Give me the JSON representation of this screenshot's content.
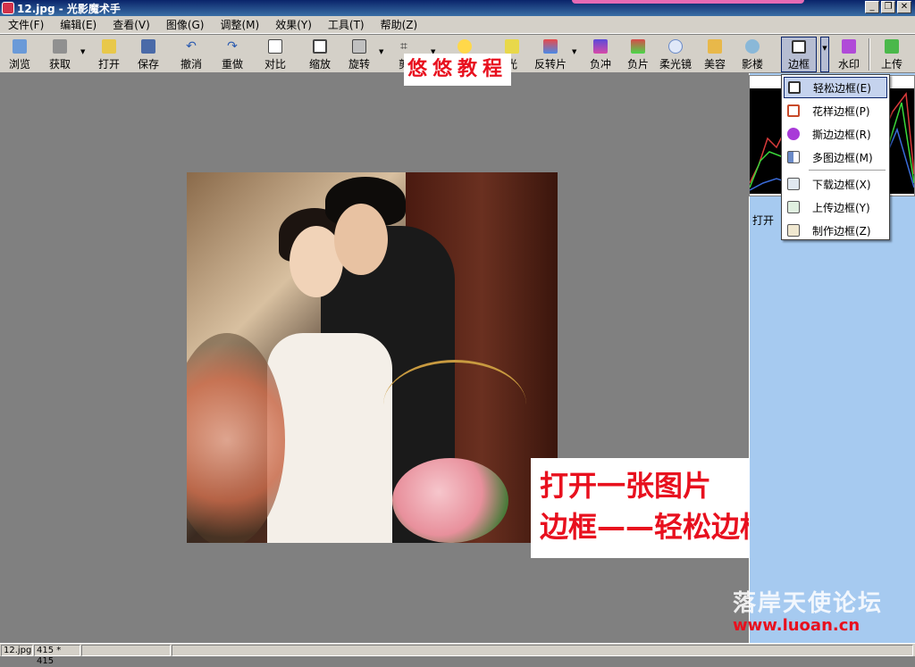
{
  "window": {
    "title": "12.jpg - 光影魔术手"
  },
  "menu": [
    "文件(F)",
    "编辑(E)",
    "查看(V)",
    "图像(G)",
    "调整(M)",
    "效果(Y)",
    "工具(T)",
    "帮助(Z)"
  ],
  "toolbar": {
    "browse": "浏览",
    "acquire": "获取",
    "open": "打开",
    "save": "保存",
    "undo": "撤消",
    "redo": "重做",
    "compare": "对比",
    "zoom": "缩放",
    "rotate": "旋转",
    "crop": "剪",
    "exposure": "曝",
    "highlight": "光",
    "reversal": "反转片",
    "negative_punch": "负冲",
    "negative": "负片",
    "soft_lens": "柔光镜",
    "beauty": "美容",
    "studio": "影楼",
    "frame": "边框",
    "watermark": "水印",
    "upload": "上传"
  },
  "banner": "悠悠教程",
  "frame_menu": {
    "items": [
      "轻松边框(E)",
      "花样边框(P)",
      "撕边边框(R)",
      "多图边框(M)",
      "下载边框(X)",
      "上传边框(Y)",
      "制作边框(Z)"
    ],
    "selected": "轻松边框(E)"
  },
  "panel": {
    "label": "打开"
  },
  "caption": {
    "line1": "打开一张图片",
    "line2": "边框——轻松边框"
  },
  "status": {
    "filename": "12.jpg",
    "size": "415 * 415"
  },
  "watermark_site": {
    "name": "落岸天使论坛",
    "url": "www.luoan.cn"
  },
  "colors": {
    "accent": "#0a246a",
    "highlight_red": "#e8101e"
  }
}
